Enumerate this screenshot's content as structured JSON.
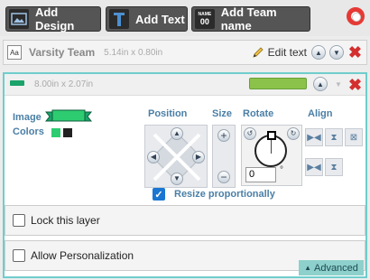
{
  "toolbar": {
    "add_design": "Add Design",
    "add_text": "Add Text",
    "add_team_name": "Add Team name",
    "team_icon_top": "NAME",
    "team_icon_bottom": "00"
  },
  "text_layer": {
    "icon": "Aa",
    "name": "Varsity Team",
    "dimensions": "5.14in x 0.80in",
    "edit_label": "Edit text"
  },
  "image_layer": {
    "dimensions": "8.00in x 2.07in",
    "image_label": "Image",
    "colors_label": "Colors",
    "colors": [
      "#2ecc71",
      "#222222"
    ],
    "accent": "#6fcdcc"
  },
  "controls": {
    "position": "Position",
    "size": "Size",
    "rotate": "Rotate",
    "align": "Align",
    "rotate_value": "0",
    "degree": "°",
    "resize_label": "Resize proportionally",
    "resize_checked": "✓"
  },
  "options": {
    "lock": "Lock this layer",
    "personalize": "Allow Personalization",
    "advanced": "Advanced"
  }
}
